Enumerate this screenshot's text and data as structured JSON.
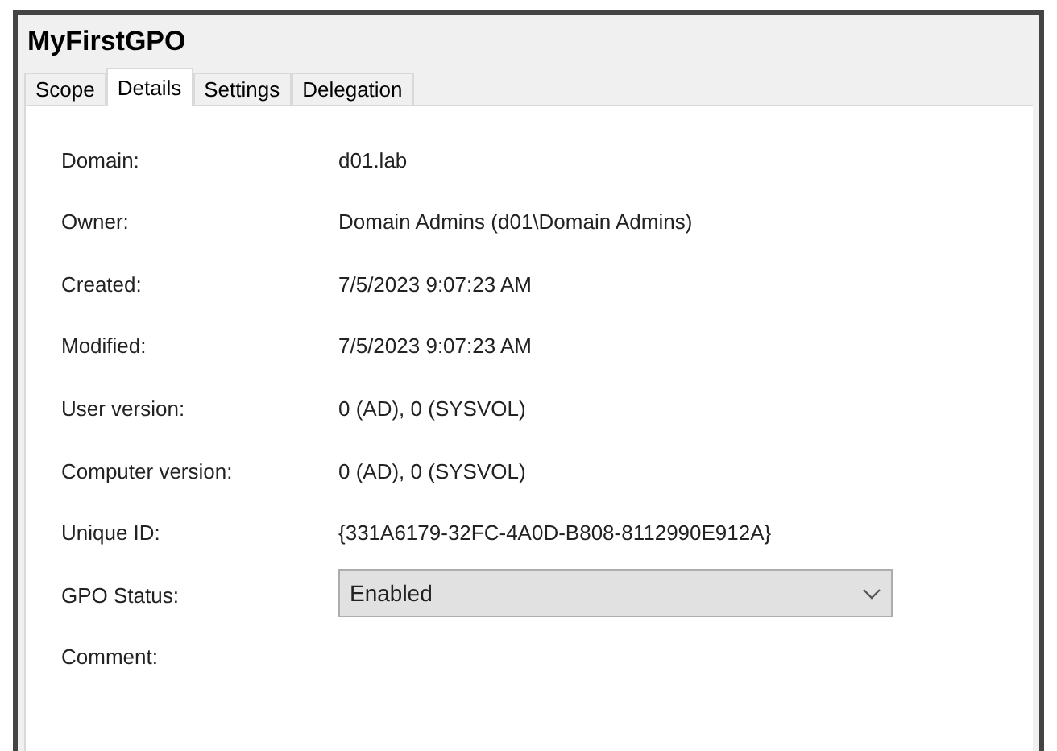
{
  "window": {
    "title": "MyFirstGPO"
  },
  "tabs": [
    {
      "label": "Scope",
      "selected": false
    },
    {
      "label": "Details",
      "selected": true
    },
    {
      "label": "Settings",
      "selected": false
    },
    {
      "label": "Delegation",
      "selected": false
    }
  ],
  "details": [
    {
      "label": "Domain:",
      "value": "d01.lab",
      "kind": "text"
    },
    {
      "label": "Owner:",
      "value": "Domain Admins (d01\\Domain Admins)",
      "kind": "text"
    },
    {
      "label": "Created:",
      "value": "7/5/2023 9:07:23 AM",
      "kind": "text"
    },
    {
      "label": "Modified:",
      "value": "7/5/2023 9:07:23 AM",
      "kind": "text"
    },
    {
      "label": "User version:",
      "value": "0 (AD), 0 (SYSVOL)",
      "kind": "text"
    },
    {
      "label": "Computer version:",
      "value": "0 (AD), 0 (SYSVOL)",
      "kind": "text"
    },
    {
      "label": "Unique ID:",
      "value": "{331A6179-32FC-4A0D-B808-8112990E912A}",
      "kind": "field"
    },
    {
      "label": "GPO Status:",
      "value": "Enabled",
      "kind": "dropdown"
    },
    {
      "label": "Comment:",
      "kind": "label"
    }
  ]
}
